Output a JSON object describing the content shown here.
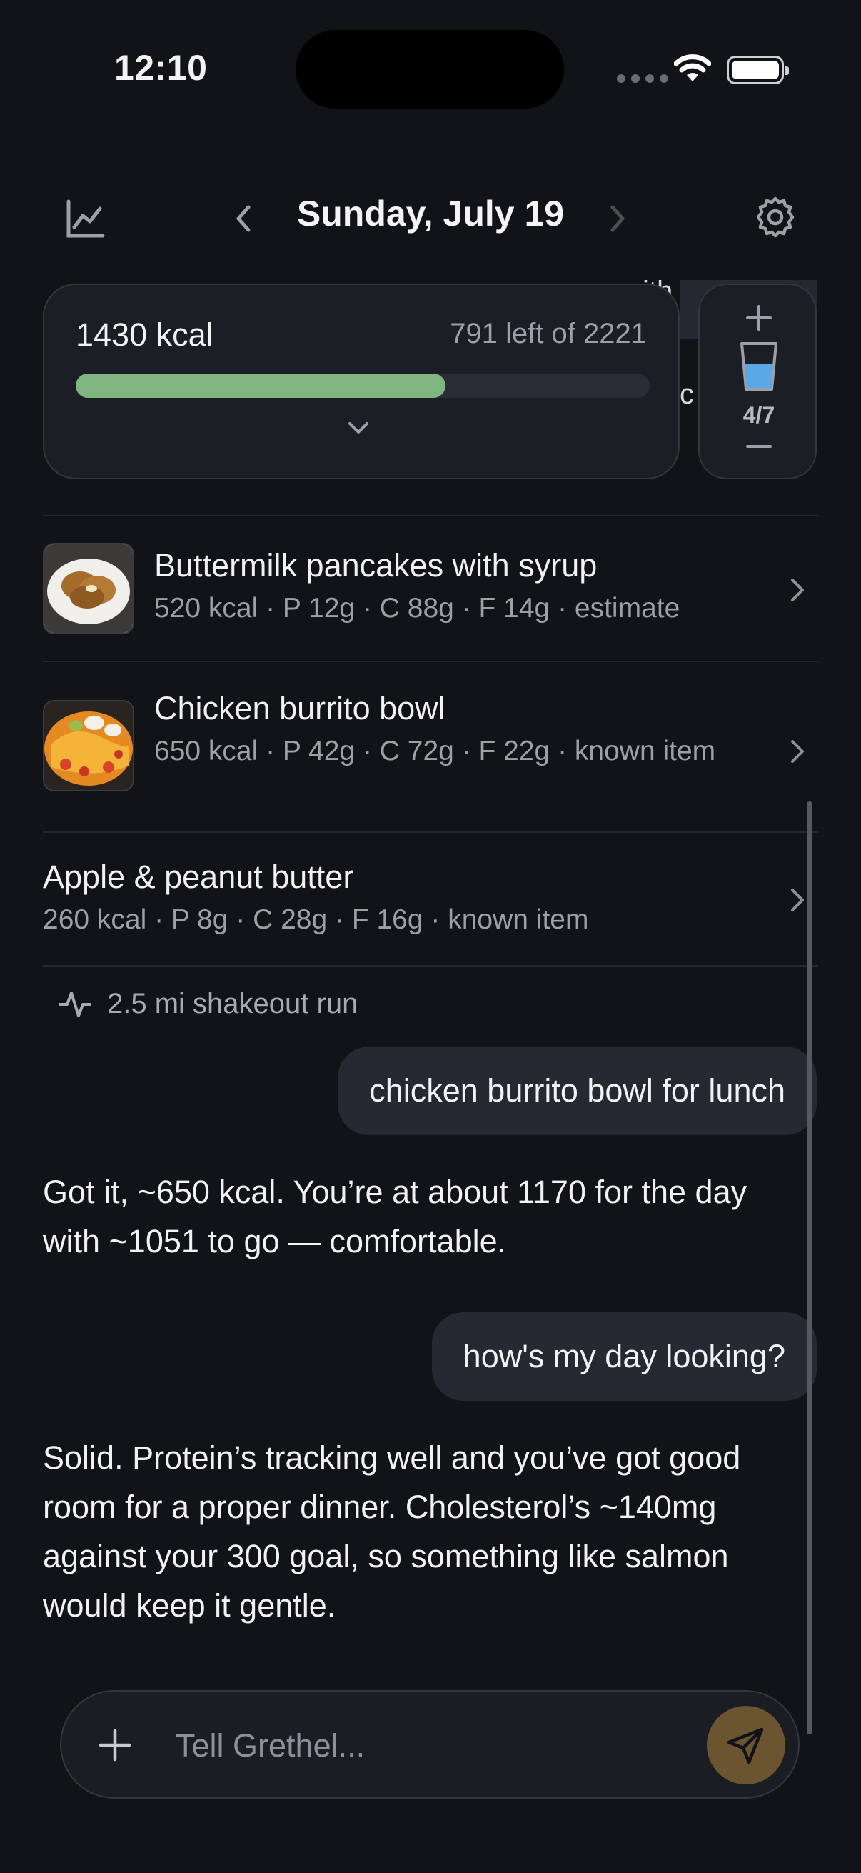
{
  "status_bar": {
    "time": "12:10"
  },
  "header": {
    "date": "Sunday, July 19"
  },
  "summary": {
    "consumed": "1430 kcal",
    "remaining": "791 left of 2221",
    "progress_fraction": 0.644
  },
  "behind_card_text": {
    "line1": "ith c",
    "line2": "c"
  },
  "water": {
    "count": "4/7",
    "fill_fraction": 0.571
  },
  "food_items": [
    {
      "title": "Buttermilk pancakes with syrup",
      "subtitle": "520 kcal · P 12g · C 88g · F 14g · estimate",
      "thumb": "pancakes"
    },
    {
      "title": "Chicken burrito bowl",
      "subtitle": "650 kcal · P 42g · C 72g · F 22g · known item",
      "thumb": "burrito-bowl"
    },
    {
      "title": "Apple & peanut butter",
      "subtitle": "260 kcal · P 8g · C 28g · F 16g · known item"
    }
  ],
  "activity": {
    "label": "2.5 mi shakeout run",
    "icon": "activity-pulse-icon"
  },
  "chat": [
    {
      "role": "user",
      "text": "chicken burrito bowl for lunch"
    },
    {
      "role": "assistant",
      "text": "Got it, ~650 kcal. You’re at about 1170 for the day with ~1051 to go — comfortable."
    },
    {
      "role": "user",
      "text": "how's my day looking?"
    },
    {
      "role": "assistant",
      "text": "Solid. Protein’s tracking well and you’ve got good room for a proper dinner. Cholesterol’s ~140mg against your 300 goal, so something like salmon would keep it gentle."
    }
  ],
  "composer": {
    "placeholder": "Tell Grethel..."
  },
  "colors": {
    "background": "#121317",
    "progress": "#7fb57f",
    "water": "#5aa9e6",
    "send": "#6b5430"
  }
}
